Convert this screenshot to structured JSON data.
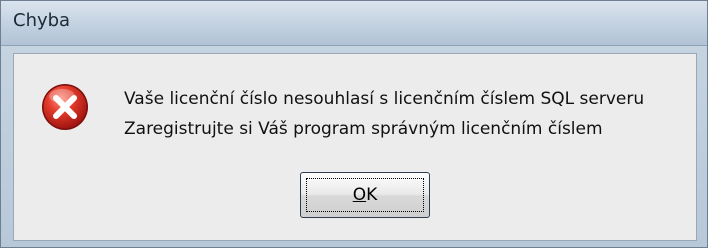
{
  "window": {
    "title": "Chyba"
  },
  "message": {
    "line1": "Vaše licenční číslo nesouhlasí s licenčním číslem SQL serveru",
    "line2": "Zaregistrujte si Váš program správným licenčním číslem"
  },
  "icon": {
    "name": "error-icon",
    "color": "#c62828"
  },
  "buttons": {
    "ok_label": "OK"
  }
}
